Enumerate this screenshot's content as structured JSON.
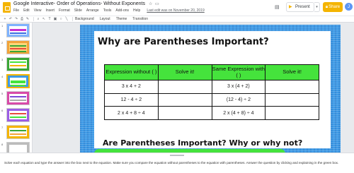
{
  "header": {
    "doc_title": "Google Interactive- Order of Operations- Without Exponents",
    "menu": [
      "File",
      "Edit",
      "View",
      "Insert",
      "Format",
      "Slide",
      "Arrange",
      "Tools",
      "Add-ons",
      "Help"
    ],
    "last_edit": "Last edit was on November 20, 2019",
    "present_label": "Present",
    "share_label": "Share",
    "avatar_initial": "J"
  },
  "toolbar": {
    "background_label": "Background",
    "layout_label": "Layout",
    "theme_label": "Theme",
    "transition_label": "Transition"
  },
  "filmstrip": {
    "slide_numbers": [
      "1",
      "2",
      "3",
      "4",
      "5",
      "6",
      "7",
      "8"
    ],
    "active_index": 3
  },
  "slide": {
    "title": "Why are Parentheses Important?",
    "table": {
      "headers": [
        "Expression without ( )",
        "Solve it!",
        "Same Expression with ( )",
        "Solve it!"
      ],
      "rows": [
        [
          "3 x 4 + 2",
          "",
          "3 x (4 + 2)",
          ""
        ],
        [
          "12 - 4 ÷ 2",
          "",
          "(12 - 4) ÷ 2",
          ""
        ],
        [
          "2 x 4 + 8 ÷ 4",
          "",
          "2 x (4 + 8) ÷ 4",
          ""
        ]
      ]
    },
    "question": "Are Parentheses Important? Why or why not?",
    "colors": {
      "green": "#45e33c",
      "blue": "#3d9ae6"
    }
  },
  "notes": {
    "text": "Solve each equation and type the answer into the box next to the equation.  Make sure you compare the equation without parentheses to the equation with parentheses.  Answer the question by clicking and explaining in the green box."
  }
}
